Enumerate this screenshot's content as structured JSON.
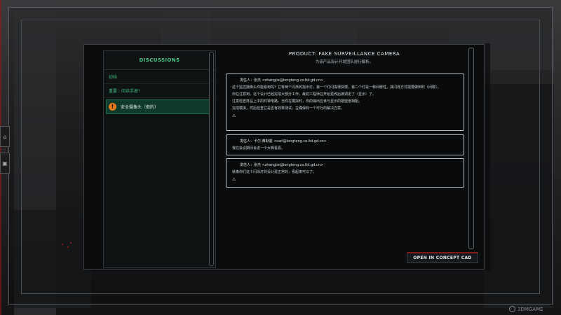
{
  "sidebar": {
    "header": "DISCUSSIONS",
    "items": [
      {
        "label": "初始"
      },
      {
        "label": "重要：阅读手册！"
      },
      {
        "label": "安全摄像头（假的）",
        "active": true
      }
    ]
  },
  "product": {
    "title": "PRODUCT: FAKE SURVEILLANCE CAMERA",
    "subtitle": "为该产品设计开发团队进行解析。"
  },
  "messages": [
    {
      "from": "发信人：张杰 <zhangjie@longteng.co.ltd.gd.cn>",
      "lines": [
        "这个监控摄像头你能看到吗？它有两个闪烁的指示灯，第一个灯闪得很快慢，第二个灯是一种间歇性，其闪烁方式需要做到时（间歇）。",
        "你在注意到，这个设计已经完成大部分工作，最初工程师在开始更改后被调走了（显示）了。",
        "注意检查样品上中的时钟电路，当你在模拟时，你的输出应该与显示的期望值相配。",
        "完成模拟，然后检查它是否有效果测试，在确保有一个可行的解决方案。"
      ],
      "attachment": "⚠"
    },
    {
      "from": "发信人：卡尔·蒂默曼 <carl@longteng.co.ltd.gd.cn>",
      "lines": [
        "我在会议期间会进一个大概看看。"
      ]
    },
    {
      "from": "发信人：张杰 <zhangjie@longteng.co.ltd.gd.cn>",
      "lines": [
        "就像你们这个闪烁灯的设计是正常的，看起来可以了。"
      ],
      "attachment": "⚠"
    }
  ],
  "actions": {
    "open_cad": "OPEN IN CONCEPT CAD"
  },
  "watermark": "3DMGAME",
  "colors": {
    "accent_green": "#3dbb7d",
    "warning_orange": "#e07a1c",
    "button_red": "#7b1c17"
  }
}
